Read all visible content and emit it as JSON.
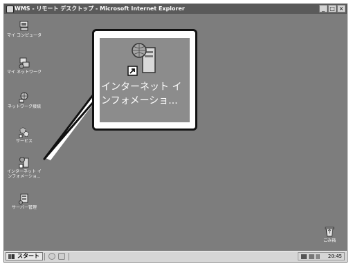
{
  "window": {
    "title": "WMS - リモート デスクトップ - Microsoft Internet Explorer",
    "min_label": "_",
    "max_label": "□",
    "close_label": "×"
  },
  "desktop": {
    "icons": [
      {
        "id": "my-computer",
        "label": "マイ コンピュータ",
        "icon": "computer-icon"
      },
      {
        "id": "my-network",
        "label": "マイ ネットワーク",
        "icon": "network-places-icon"
      },
      {
        "id": "network-connections",
        "label": "ネットワーク接続",
        "icon": "network-connections-icon"
      },
      {
        "id": "services",
        "label": "サービス",
        "icon": "services-icon"
      },
      {
        "id": "iis",
        "label_lines": [
          "インターネット イ",
          "ンフォメーショ..."
        ],
        "icon": "iis-icon"
      },
      {
        "id": "server-manage",
        "label": "サーバー管理",
        "icon": "server-manage-icon"
      },
      {
        "id": "recycle-bin",
        "label": "ごみ箱",
        "icon": "recycle-bin-icon"
      }
    ],
    "callout": {
      "label_lines": [
        "インターネット イ",
        "ンフォメーショ..."
      ]
    }
  },
  "taskbar": {
    "start_label": "スタート",
    "clock": "20:45"
  },
  "colors": {
    "desktop": "#7d7d7d",
    "titlebar": "#5a5a5a",
    "callout_border": "#111111"
  }
}
